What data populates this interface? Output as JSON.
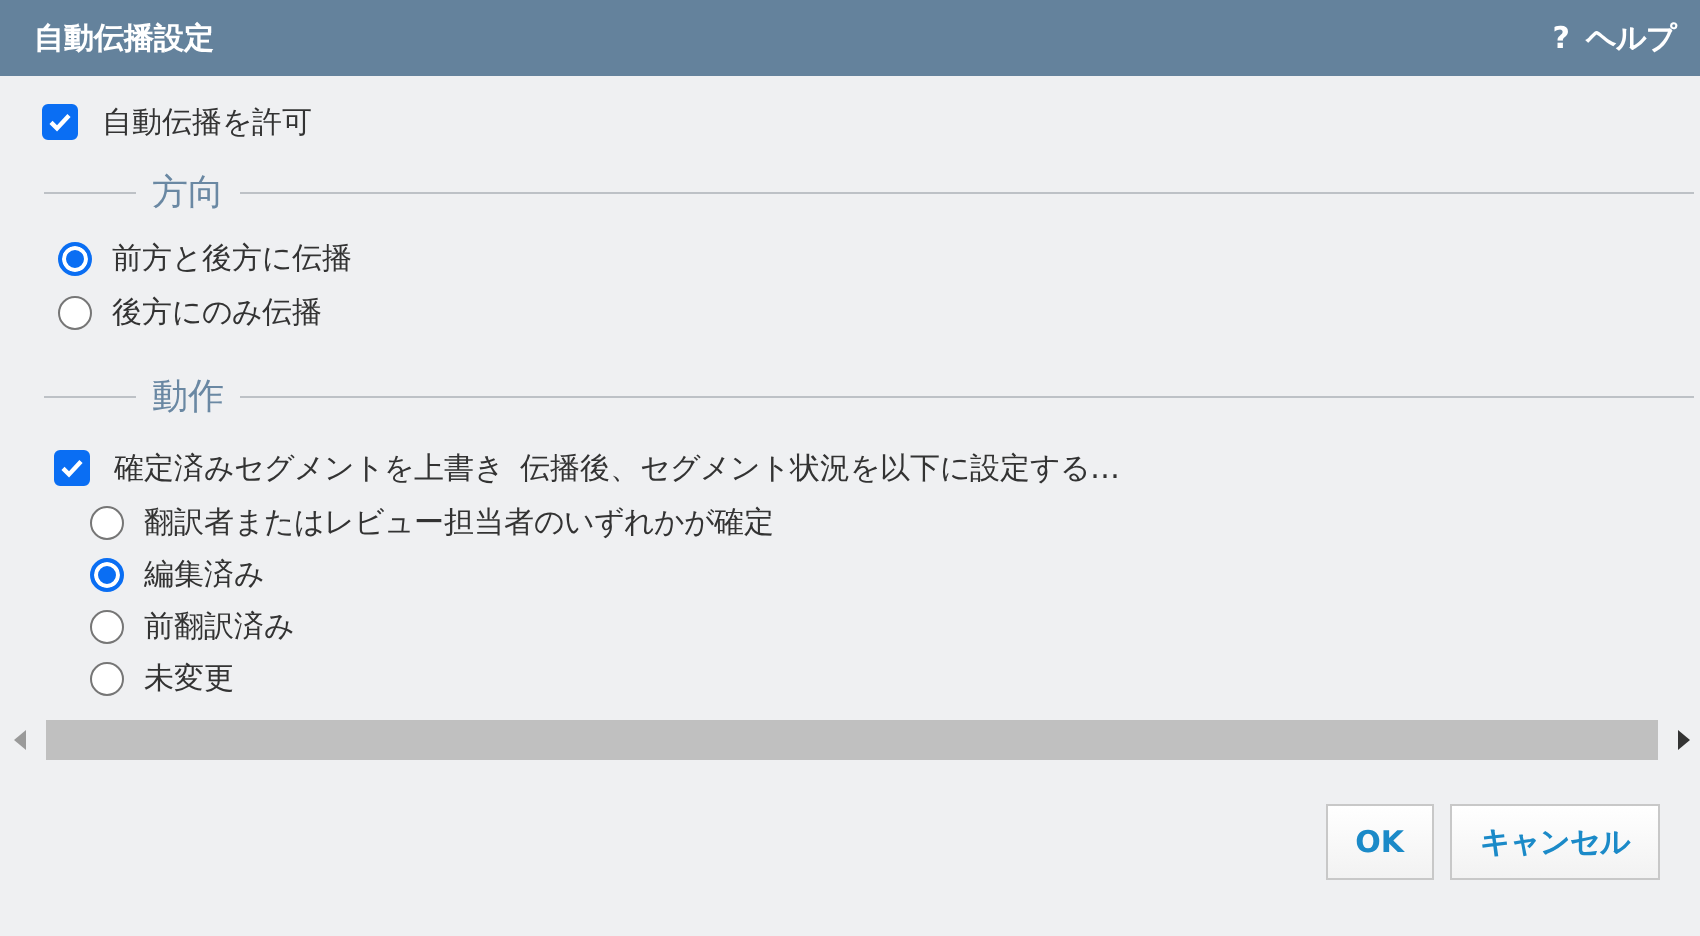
{
  "window": {
    "title": "自動伝播設定",
    "help": {
      "icon": "?",
      "label": "ヘルプ"
    }
  },
  "allow": {
    "label": "自動伝播を許可",
    "checked": true
  },
  "direction": {
    "legend": "方向",
    "options": [
      {
        "label": "前方と後方に伝播",
        "selected": true
      },
      {
        "label": "後方にのみ伝播",
        "selected": false
      }
    ]
  },
  "action": {
    "legend": "動作",
    "overwrite": {
      "label": "確定済みセグメントを上書き",
      "checked": true
    },
    "note": "伝播後、セグメント状況を以下に設定する…",
    "options": [
      {
        "label": "翻訳者またはレビュー担当者のいずれかが確定",
        "selected": false
      },
      {
        "label": "編集済み",
        "selected": true
      },
      {
        "label": "前翻訳済み",
        "selected": false
      },
      {
        "label": "未変更",
        "selected": false
      }
    ]
  },
  "buttons": [
    "OK",
    "キャンセル"
  ]
}
